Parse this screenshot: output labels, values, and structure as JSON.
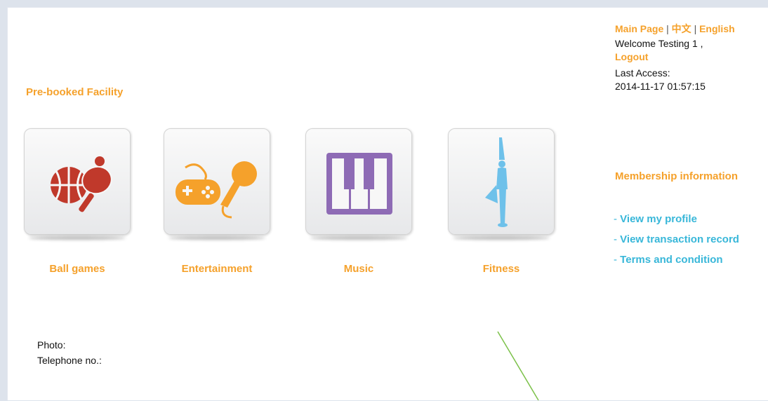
{
  "header": {
    "main_page": "Main Page",
    "separator": "|",
    "chinese": "中文",
    "english": "English",
    "welcome": "Welcome Testing 1 ,",
    "logout": "Logout",
    "last_access_label": "Last Access:",
    "last_access_value": "2014-11-17 01:57:15"
  },
  "prebooked": {
    "title": "Pre-booked Facility",
    "items": [
      {
        "label": "Ball games",
        "icon": "ball-games-icon",
        "color": "#c0392b"
      },
      {
        "label": "Entertainment",
        "icon": "game-controller-microphone-icon",
        "color": "#f5a12b"
      },
      {
        "label": "Music",
        "icon": "piano-keys-icon",
        "color": "#8e6bb5"
      },
      {
        "label": "Fitness",
        "icon": "yoga-figure-icon",
        "color": "#6ec1ea"
      }
    ]
  },
  "profile": {
    "photo_label": "Photo:",
    "telephone_label": "Telephone no.:"
  },
  "membership": {
    "title": "Membership information",
    "dash": "-",
    "links": [
      {
        "label": "View my profile"
      },
      {
        "label": "View transaction record"
      },
      {
        "label": "Terms and condition"
      }
    ]
  },
  "colors": {
    "accent_orange": "#f5a12b",
    "link_blue": "#38b7d9"
  }
}
